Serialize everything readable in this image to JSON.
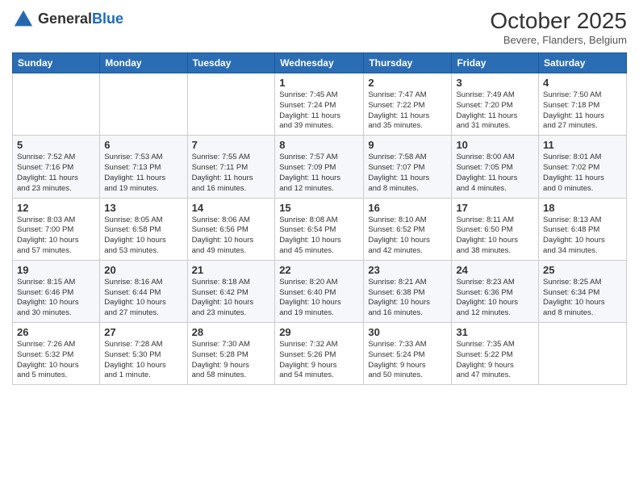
{
  "header": {
    "logo_line1": "General",
    "logo_line2": "Blue",
    "month": "October 2025",
    "location": "Bevere, Flanders, Belgium"
  },
  "days_of_week": [
    "Sunday",
    "Monday",
    "Tuesday",
    "Wednesday",
    "Thursday",
    "Friday",
    "Saturday"
  ],
  "weeks": [
    [
      {
        "num": "",
        "info": ""
      },
      {
        "num": "",
        "info": ""
      },
      {
        "num": "",
        "info": ""
      },
      {
        "num": "1",
        "info": "Sunrise: 7:45 AM\nSunset: 7:24 PM\nDaylight: 11 hours\nand 39 minutes."
      },
      {
        "num": "2",
        "info": "Sunrise: 7:47 AM\nSunset: 7:22 PM\nDaylight: 11 hours\nand 35 minutes."
      },
      {
        "num": "3",
        "info": "Sunrise: 7:49 AM\nSunset: 7:20 PM\nDaylight: 11 hours\nand 31 minutes."
      },
      {
        "num": "4",
        "info": "Sunrise: 7:50 AM\nSunset: 7:18 PM\nDaylight: 11 hours\nand 27 minutes."
      }
    ],
    [
      {
        "num": "5",
        "info": "Sunrise: 7:52 AM\nSunset: 7:16 PM\nDaylight: 11 hours\nand 23 minutes."
      },
      {
        "num": "6",
        "info": "Sunrise: 7:53 AM\nSunset: 7:13 PM\nDaylight: 11 hours\nand 19 minutes."
      },
      {
        "num": "7",
        "info": "Sunrise: 7:55 AM\nSunset: 7:11 PM\nDaylight: 11 hours\nand 16 minutes."
      },
      {
        "num": "8",
        "info": "Sunrise: 7:57 AM\nSunset: 7:09 PM\nDaylight: 11 hours\nand 12 minutes."
      },
      {
        "num": "9",
        "info": "Sunrise: 7:58 AM\nSunset: 7:07 PM\nDaylight: 11 hours\nand 8 minutes."
      },
      {
        "num": "10",
        "info": "Sunrise: 8:00 AM\nSunset: 7:05 PM\nDaylight: 11 hours\nand 4 minutes."
      },
      {
        "num": "11",
        "info": "Sunrise: 8:01 AM\nSunset: 7:02 PM\nDaylight: 11 hours\nand 0 minutes."
      }
    ],
    [
      {
        "num": "12",
        "info": "Sunrise: 8:03 AM\nSunset: 7:00 PM\nDaylight: 10 hours\nand 57 minutes."
      },
      {
        "num": "13",
        "info": "Sunrise: 8:05 AM\nSunset: 6:58 PM\nDaylight: 10 hours\nand 53 minutes."
      },
      {
        "num": "14",
        "info": "Sunrise: 8:06 AM\nSunset: 6:56 PM\nDaylight: 10 hours\nand 49 minutes."
      },
      {
        "num": "15",
        "info": "Sunrise: 8:08 AM\nSunset: 6:54 PM\nDaylight: 10 hours\nand 45 minutes."
      },
      {
        "num": "16",
        "info": "Sunrise: 8:10 AM\nSunset: 6:52 PM\nDaylight: 10 hours\nand 42 minutes."
      },
      {
        "num": "17",
        "info": "Sunrise: 8:11 AM\nSunset: 6:50 PM\nDaylight: 10 hours\nand 38 minutes."
      },
      {
        "num": "18",
        "info": "Sunrise: 8:13 AM\nSunset: 6:48 PM\nDaylight: 10 hours\nand 34 minutes."
      }
    ],
    [
      {
        "num": "19",
        "info": "Sunrise: 8:15 AM\nSunset: 6:46 PM\nDaylight: 10 hours\nand 30 minutes."
      },
      {
        "num": "20",
        "info": "Sunrise: 8:16 AM\nSunset: 6:44 PM\nDaylight: 10 hours\nand 27 minutes."
      },
      {
        "num": "21",
        "info": "Sunrise: 8:18 AM\nSunset: 6:42 PM\nDaylight: 10 hours\nand 23 minutes."
      },
      {
        "num": "22",
        "info": "Sunrise: 8:20 AM\nSunset: 6:40 PM\nDaylight: 10 hours\nand 19 minutes."
      },
      {
        "num": "23",
        "info": "Sunrise: 8:21 AM\nSunset: 6:38 PM\nDaylight: 10 hours\nand 16 minutes."
      },
      {
        "num": "24",
        "info": "Sunrise: 8:23 AM\nSunset: 6:36 PM\nDaylight: 10 hours\nand 12 minutes."
      },
      {
        "num": "25",
        "info": "Sunrise: 8:25 AM\nSunset: 6:34 PM\nDaylight: 10 hours\nand 8 minutes."
      }
    ],
    [
      {
        "num": "26",
        "info": "Sunrise: 7:26 AM\nSunset: 5:32 PM\nDaylight: 10 hours\nand 5 minutes."
      },
      {
        "num": "27",
        "info": "Sunrise: 7:28 AM\nSunset: 5:30 PM\nDaylight: 10 hours\nand 1 minute."
      },
      {
        "num": "28",
        "info": "Sunrise: 7:30 AM\nSunset: 5:28 PM\nDaylight: 9 hours\nand 58 minutes."
      },
      {
        "num": "29",
        "info": "Sunrise: 7:32 AM\nSunset: 5:26 PM\nDaylight: 9 hours\nand 54 minutes."
      },
      {
        "num": "30",
        "info": "Sunrise: 7:33 AM\nSunset: 5:24 PM\nDaylight: 9 hours\nand 50 minutes."
      },
      {
        "num": "31",
        "info": "Sunrise: 7:35 AM\nSunset: 5:22 PM\nDaylight: 9 hours\nand 47 minutes."
      },
      {
        "num": "",
        "info": ""
      }
    ]
  ]
}
